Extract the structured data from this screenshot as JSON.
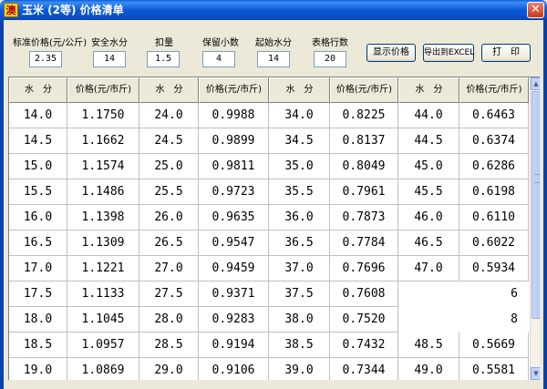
{
  "window": {
    "title": "玉米 (2等) 价格清单",
    "icon_char": "澳",
    "close_glyph": "✕"
  },
  "params": [
    {
      "label": "标准价格(元/公斤)",
      "value": "2.35"
    },
    {
      "label": "安全水分",
      "value": "14"
    },
    {
      "label": "扣量",
      "value": "1.5"
    },
    {
      "label": "保留小数",
      "value": "4"
    },
    {
      "label": "起始水分",
      "value": "14"
    },
    {
      "label": "表格行数",
      "value": "20"
    }
  ],
  "buttons": {
    "show_price": "显示价格",
    "export_excel": "导出到EXCEL",
    "print": "打　印"
  },
  "table": {
    "headers": [
      "水　分",
      "价格(元/市斤)",
      "水　分",
      "价格(元/市斤)",
      "水　分",
      "价格(元/市斤)",
      "水　分",
      "价格(元/市斤)"
    ],
    "rows": [
      [
        "14.0",
        "1.1750",
        "24.0",
        "0.9988",
        "34.0",
        "0.8225",
        "44.0",
        "0.6463"
      ],
      [
        "14.5",
        "1.1662",
        "24.5",
        "0.9899",
        "34.5",
        "0.8137",
        "44.5",
        "0.6374"
      ],
      [
        "15.0",
        "1.1574",
        "25.0",
        "0.9811",
        "35.0",
        "0.8049",
        "45.0",
        "0.6286"
      ],
      [
        "15.5",
        "1.1486",
        "25.5",
        "0.9723",
        "35.5",
        "0.7961",
        "45.5",
        "0.6198"
      ],
      [
        "16.0",
        "1.1398",
        "26.0",
        "0.9635",
        "36.0",
        "0.7873",
        "46.0",
        "0.6110"
      ],
      [
        "16.5",
        "1.1309",
        "26.5",
        "0.9547",
        "36.5",
        "0.7784",
        "46.5",
        "0.6022"
      ],
      [
        "17.0",
        "1.1221",
        "27.0",
        "0.9459",
        "37.0",
        "0.7696",
        "47.0",
        "0.5934"
      ],
      [
        "17.5",
        "1.1133",
        "27.5",
        "0.9371",
        "37.5",
        "0.7608",
        "",
        "6"
      ],
      [
        "18.0",
        "1.1045",
        "28.0",
        "0.9283",
        "38.0",
        "0.7520",
        "",
        "8"
      ],
      [
        "18.5",
        "1.0957",
        "28.5",
        "0.9194",
        "38.5",
        "0.7432",
        "48.5",
        "0.5669"
      ],
      [
        "19.0",
        "1.0869",
        "29.0",
        "0.9106",
        "39.0",
        "0.7344",
        "49.0",
        "0.5581"
      ]
    ]
  },
  "scrollbar": {
    "up_glyph": "▲",
    "down_glyph": "▼"
  }
}
